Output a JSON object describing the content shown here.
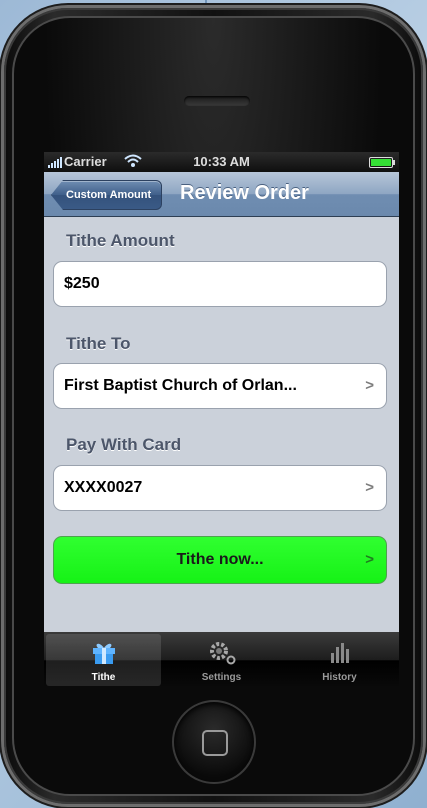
{
  "status_bar": {
    "carrier": "Carrier",
    "time": "10:33 AM"
  },
  "nav": {
    "back_label": "Custom Amount",
    "title": "Review Order"
  },
  "sections": {
    "amount_label": "Tithe Amount",
    "amount_value": "$250",
    "tithe_to_label": "Tithe To",
    "tithe_to_value": "First Baptist Church of Orlan...",
    "pay_with_label": "Pay With Card",
    "pay_with_value": "XXXX0027"
  },
  "action": {
    "button_label": "Tithe now..."
  },
  "tabbar": {
    "tabs": [
      {
        "label": "Tithe",
        "icon": "gift-icon",
        "active": true
      },
      {
        "label": "Settings",
        "icon": "gear-icon",
        "active": false
      },
      {
        "label": "History",
        "icon": "bar-chart-icon",
        "active": false
      }
    ]
  },
  "colors": {
    "nav_bar": "#7d98bb",
    "action_button": "#20ff20",
    "screen_background": "#cbd1da",
    "battery_level": "#35e035"
  }
}
